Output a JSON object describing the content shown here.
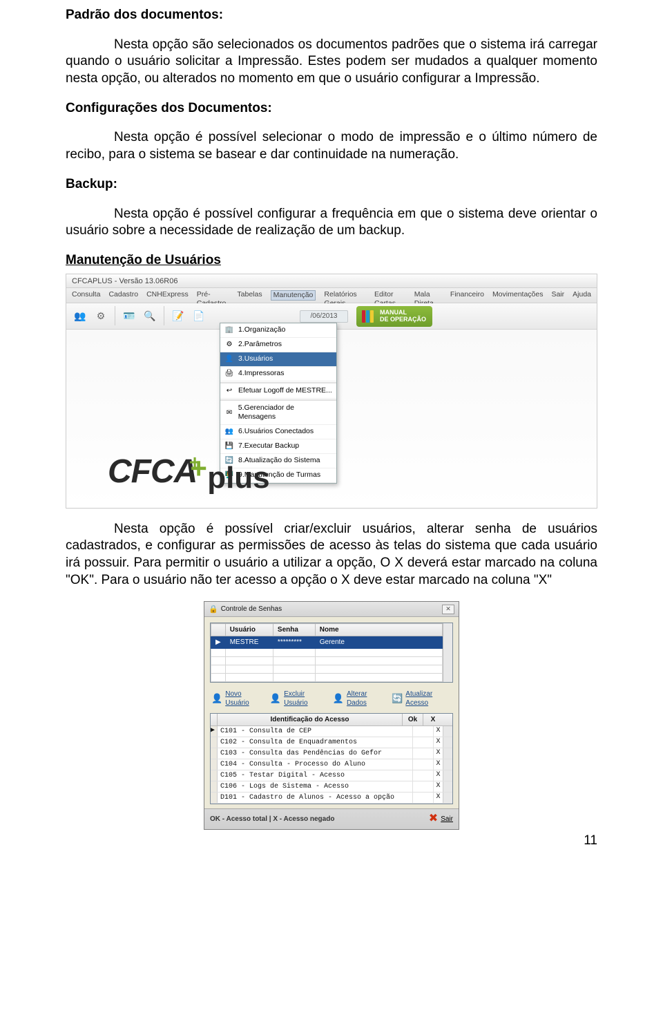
{
  "h1": "Padrão dos documentos:",
  "p1": "Nesta opção são selecionados os documentos padrões que o sistema irá carregar quando o usuário solicitar a Impressão. Estes podem ser mudados a qualquer momento nesta opção, ou alterados no momento em que o usuário configurar a Impressão.",
  "h2": "Configurações dos Documentos:",
  "p2": "Nesta opção é possível selecionar o modo de impressão e o último número de recibo, para o sistema se basear e dar continuidade na numeração.",
  "h3": "Backup:",
  "p3": "Nesta opção é possível configurar a frequência em que o sistema deve orientar o usuário sobre a necessidade de realização de um backup.",
  "h4": "Manutenção de Usuários",
  "ss1": {
    "title": "CFCAPLUS - Versão 13.06R06",
    "menubar": [
      "Consulta",
      "Cadastro",
      "CNHExpress",
      "Pré-Cadastro",
      "Tabelas",
      "Manutenção",
      "Relatórios Gerais",
      "Editor Cartas",
      "Mala Direta",
      "Financeiro",
      "Movimentações",
      "Sair",
      "Ajuda"
    ],
    "date_fragment": "/06/2013",
    "manual": "MANUAL\nDE OPERAÇÃO",
    "dropdown": [
      "1.Organização",
      "2.Parâmetros",
      "3.Usuários",
      "4.Impressoras",
      "Efetuar Logoff de MESTRE...",
      "5.Gerenciador de Mensagens",
      "6.Usuários Conectados",
      "7.Executar Backup",
      "8.Atualização do Sistema",
      "9.Manutenção de Turmas"
    ]
  },
  "p4": "Nesta opção é possível criar/excluir usuários, alterar senha de usuários cadastrados, e configurar as permissões de acesso às telas do sistema que cada usuário irá possuir. Para permitir o usuário a utilizar a opção, O X deverá estar marcado na coluna \"OK\". Para o usuário não ter acesso a opção o X deve estar marcado na coluna \"X\"",
  "ss2": {
    "title": "Controle de Senhas",
    "grid1_headers": [
      "Usuário",
      "Senha",
      "Nome"
    ],
    "grid1_row": {
      "usuario": "MESTRE",
      "senha": "*********",
      "nome": "Gerente"
    },
    "buttons": [
      "Novo Usuário",
      "Excluir Usuário",
      "Alterar Dados",
      "Atualizar Acesso"
    ],
    "grid2_header": {
      "main": "Identificação do Acesso",
      "ok": "Ok",
      "x": "X"
    },
    "grid2_rows": [
      {
        "label": "C101 - Consulta de CEP",
        "ok": "",
        "x": "X"
      },
      {
        "label": "C102 - Consulta de Enquadramentos",
        "ok": "",
        "x": "X"
      },
      {
        "label": "C103 - Consulta das Pendências do Gefor",
        "ok": "",
        "x": "X"
      },
      {
        "label": "C104 - Consulta - Processo do Aluno",
        "ok": "",
        "x": "X"
      },
      {
        "label": "C105 - Testar Digital - Acesso",
        "ok": "",
        "x": "X"
      },
      {
        "label": "C106 - Logs de Sistema - Acesso",
        "ok": "",
        "x": "X"
      },
      {
        "label": "D101 - Cadastro de Alunos - Acesso a opção",
        "ok": "",
        "x": "X"
      }
    ],
    "footer_text": "OK - Acesso total  |  X - Acesso negado",
    "sair": "Sair"
  },
  "pagenum": "11"
}
